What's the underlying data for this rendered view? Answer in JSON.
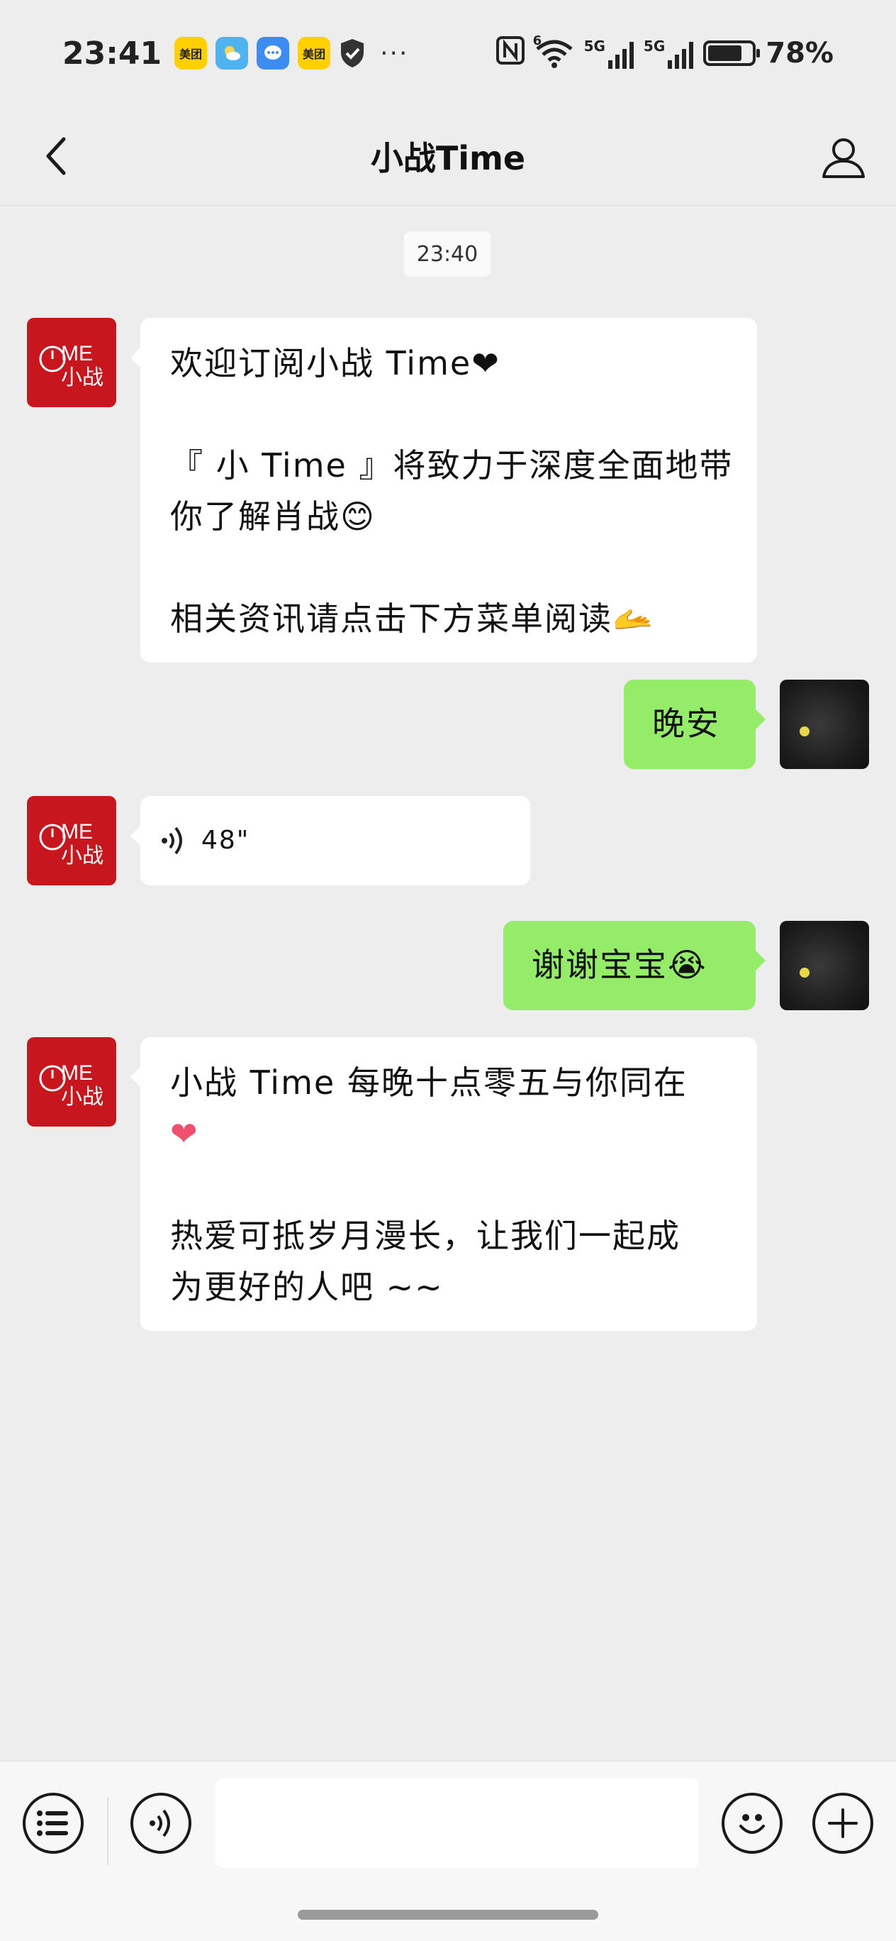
{
  "status_bar": {
    "time": "23:41",
    "app_icon_meituan_1": "美团",
    "app_icon_meituan_2": "美团",
    "network_1": "5G",
    "network_2": "5G",
    "wifi_badge": "6",
    "battery_percent": "78%",
    "battery_level": 0.78,
    "more": "···"
  },
  "header": {
    "title": "小战Time"
  },
  "chat": {
    "timestamp": "23:40",
    "messages": [
      {
        "side": "in",
        "type": "text",
        "lines": [
          "欢迎订阅小战 Time❤",
          "",
          "『 小 Time 』将致力于深度全面地带",
          "你了解肖战😊",
          "",
          "相关资讯请点击下方菜单阅读🫴"
        ]
      },
      {
        "side": "out",
        "type": "text",
        "lines": [
          "晚安"
        ]
      },
      {
        "side": "in",
        "type": "voice",
        "duration": "48\""
      },
      {
        "side": "out",
        "type": "text",
        "lines": [
          "谢谢宝宝😭"
        ]
      },
      {
        "side": "in",
        "type": "text",
        "lines": [
          "小战 Time 每晚十点零五与你同在",
          "❤",
          "",
          "热爱可抵岁月漫长，让我们一起成",
          "为更好的人吧 ~~"
        ]
      }
    ]
  },
  "brand_avatar_text": "TIME 小战",
  "input_bar": {
    "text_value": "",
    "icons": [
      "menu-list-icon",
      "voice-mode-icon",
      "emoji-icon",
      "add-icon"
    ]
  },
  "colors": {
    "chat_background": "#ededed",
    "incoming_bubble": "#ffffff",
    "outgoing_bubble": "#95ec69",
    "brand_avatar": "#c8161e"
  }
}
